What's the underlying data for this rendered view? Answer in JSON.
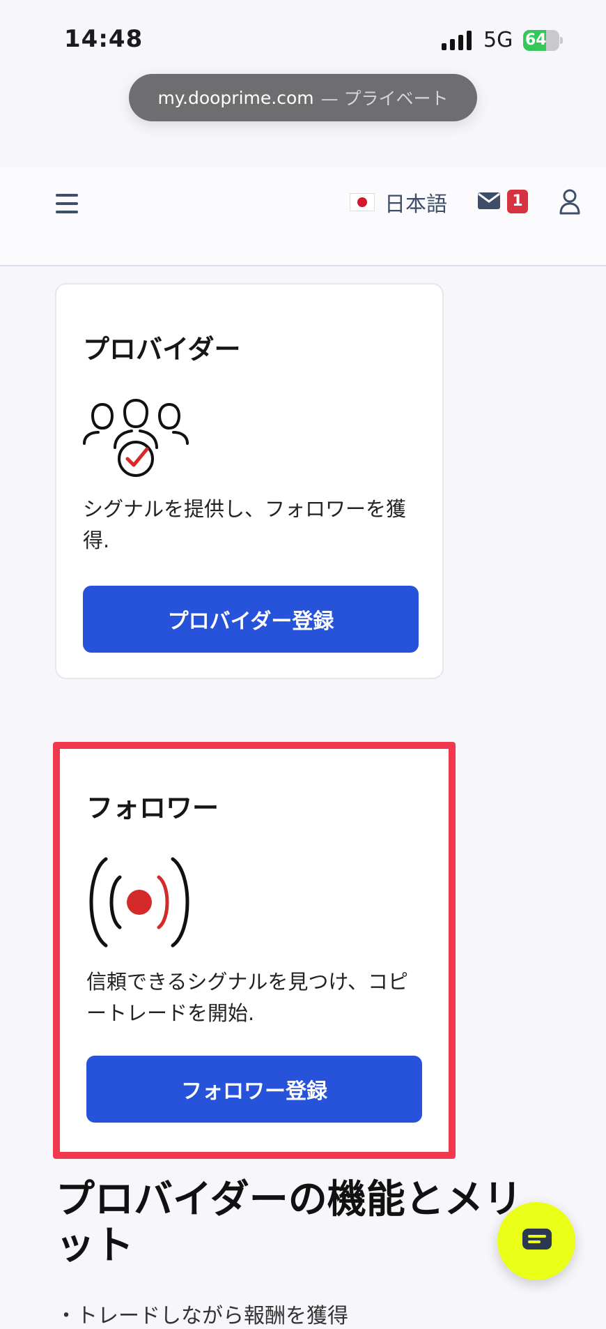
{
  "status_bar": {
    "time": "14:48",
    "network": "5G",
    "battery": "64",
    "battery_level": 0.64
  },
  "url_bar": {
    "domain": "my.dooprime.com",
    "mode": "— プライベート"
  },
  "header": {
    "language": "日本語",
    "messages_count": "1"
  },
  "cards": {
    "provider": {
      "title": "プロバイダー",
      "description": "シグナルを提供し、フォロワーを獲得.",
      "button": "プロバイダー登録",
      "icon": "users-check-icon"
    },
    "follower": {
      "title": "フォロワー",
      "description": "信頼できるシグナルを見つけ、コピートレードを開始.",
      "button": "フォロワー登録",
      "icon": "broadcast-signal-icon"
    }
  },
  "section": {
    "heading": "プロバイダーの機能とメリット",
    "partial_text": "・トレードしながら報酬を獲得"
  },
  "colors": {
    "primary_button": "#2653da",
    "highlight_border": "#f0394f",
    "chat_fab": "#eaff18",
    "badge": "#d6323f",
    "icon_red": "#d42a2a"
  }
}
